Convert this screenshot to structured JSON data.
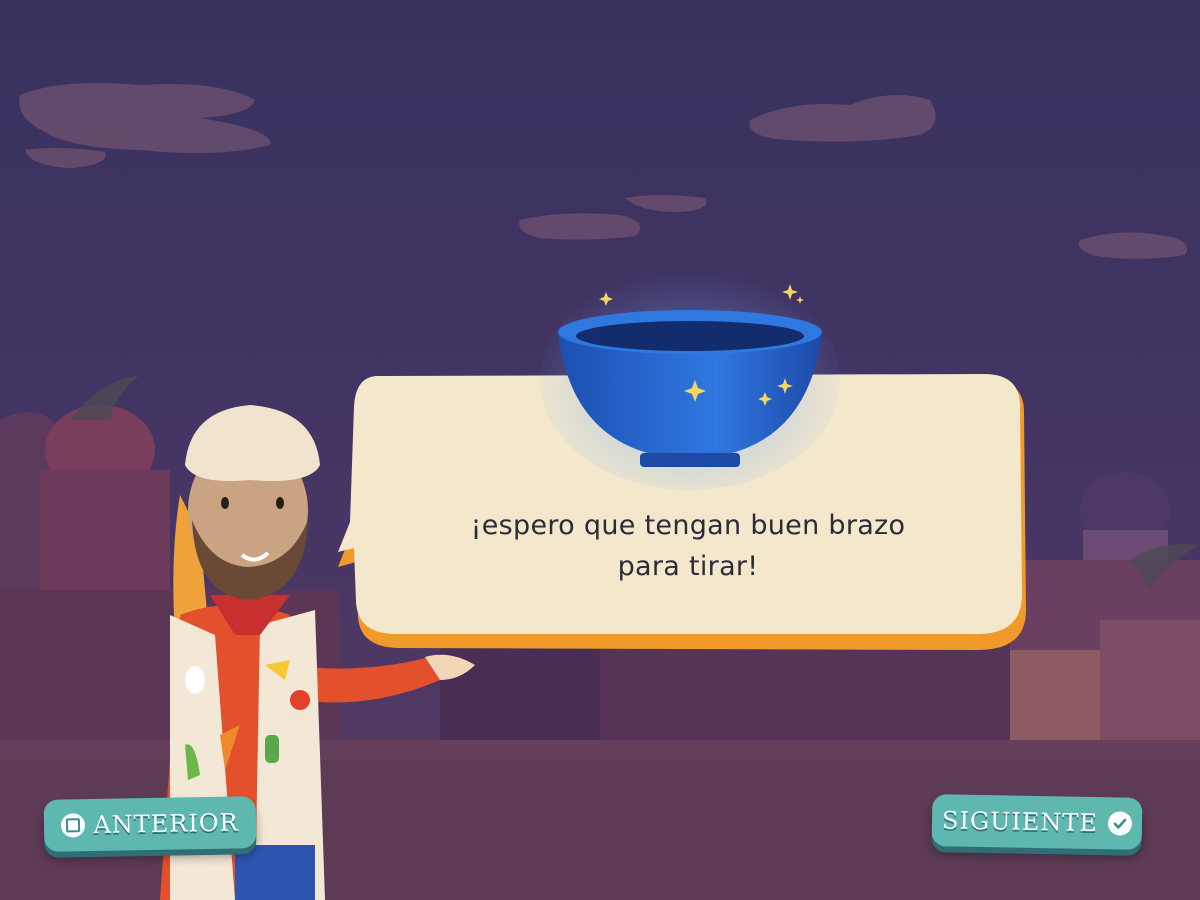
{
  "dialog": {
    "line1": "¡espero que tengan buen brazo",
    "line2": "para tirar!"
  },
  "nav": {
    "prev_label": "ANTERIOR",
    "next_label": "SIGUIENTE",
    "prev_icon": "stop-square-icon",
    "next_icon": "check-circle-icon"
  },
  "colors": {
    "sky": "#3a3158",
    "bubble": "#f3e7cc",
    "bubble_edge": "#ef9a2a",
    "bowl": "#2a6fd6",
    "button": "#5fb8b0"
  }
}
